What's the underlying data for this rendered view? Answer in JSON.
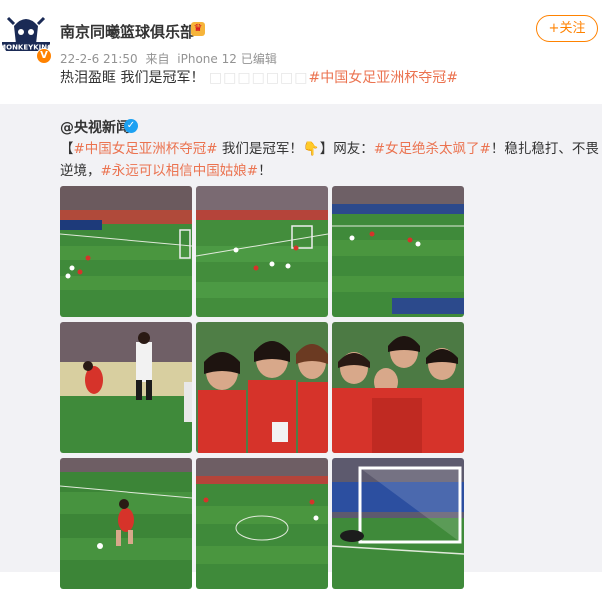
{
  "post": {
    "author": "南京同曦篮球俱乐部",
    "author_badge_icon": "membership-crown-icon",
    "time": "22-2-6 21:50",
    "from_prefix": "来自",
    "device": "iPhone 12",
    "edited": "已编辑",
    "follow_label": "+关注",
    "text_main": "热泪盈眶 我们是冠军！",
    "text_emoji_placeholders": "□□□□□□□",
    "hashtag": "#中国女足亚洲杯夺冠#",
    "avatar_logo_text": "MONKEYKING"
  },
  "repost": {
    "author": "@央视新闻",
    "verified_icon": "verified-blue-icon",
    "text_parts": [
      {
        "t": "【",
        "tag": false
      },
      {
        "t": "#中国女足亚洲杯夺冠#",
        "tag": true
      },
      {
        "t": " 我们是冠军！",
        "tag": false
      },
      {
        "t": "👇",
        "tag": false
      },
      {
        "t": "】网友：",
        "tag": false
      },
      {
        "t": "#女足绝杀太飒了#",
        "tag": true
      },
      {
        "t": "！稳扎稳打、不畏逆境，",
        "tag": false
      },
      {
        "t": "#永远可以相信中国姑娘#",
        "tag": true
      },
      {
        "t": "！",
        "tag": false
      }
    ],
    "images": [
      {
        "name": "image-1-penalty-wide"
      },
      {
        "name": "image-2-stadium-view"
      },
      {
        "name": "image-3-field-action"
      },
      {
        "name": "image-4-header-goal"
      },
      {
        "name": "image-5-players-celebrate"
      },
      {
        "name": "image-6-team-hug"
      },
      {
        "name": "image-7-player-kick"
      },
      {
        "name": "image-8-midfield"
      },
      {
        "name": "image-9-goal-net"
      }
    ]
  },
  "colors": {
    "accent": "#ff8200",
    "hashtag": "#eb7350",
    "repost_bg": "#f2f2f5",
    "pitch": "#3f8a3a"
  }
}
